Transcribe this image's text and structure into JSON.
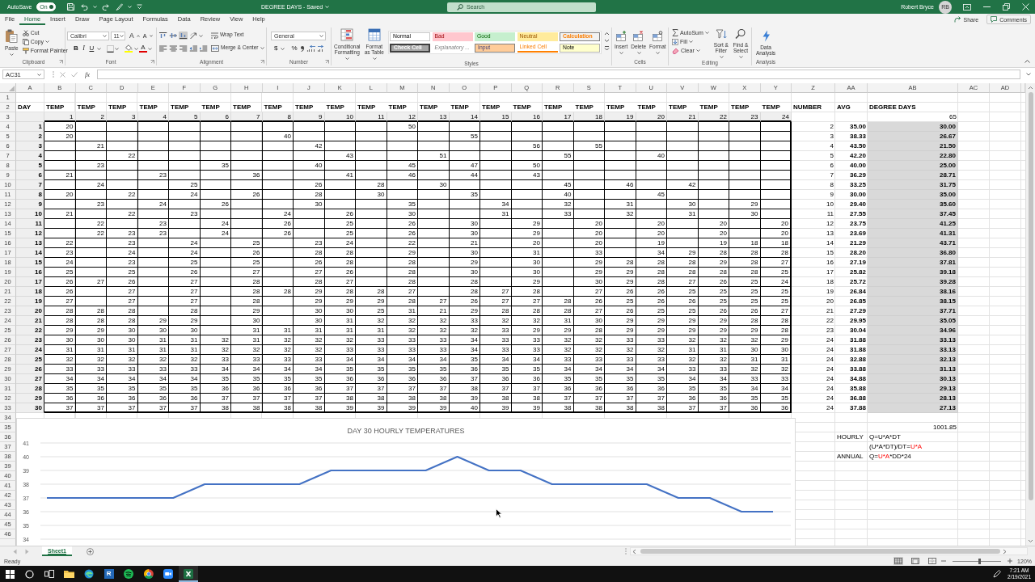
{
  "title_bar": {
    "autosave": {
      "label": "AutoSave",
      "on": true,
      "state_text": "On"
    },
    "document_title": "DEGREE DAYS - Saved",
    "search": {
      "placeholder": "Search"
    },
    "user": {
      "name": "Robert Bryce",
      "initials": "RB"
    }
  },
  "menu_tabs": [
    {
      "label": "File",
      "selected": false
    },
    {
      "label": "Home",
      "selected": true
    },
    {
      "label": "Insert",
      "selected": false
    },
    {
      "label": "Draw",
      "selected": false
    },
    {
      "label": "Page Layout",
      "selected": false
    },
    {
      "label": "Formulas",
      "selected": false
    },
    {
      "label": "Data",
      "selected": false
    },
    {
      "label": "Review",
      "selected": false
    },
    {
      "label": "View",
      "selected": false
    },
    {
      "label": "Help",
      "selected": false
    }
  ],
  "header_buttons": [
    {
      "label": "Share"
    },
    {
      "label": "Comments"
    }
  ],
  "ribbon": {
    "clipboard": {
      "label": "Clipboard",
      "paste": "Paste",
      "cut": "Cut",
      "copy": "Copy",
      "format_painter": "Format Painter"
    },
    "font": {
      "label": "Font",
      "font_name": "Calibri",
      "font_size": "11",
      "grow_font": "A",
      "shrink_font": "A",
      "bold": "B",
      "italic": "I",
      "underline": "U",
      "font_color": "A"
    },
    "alignment": {
      "label": "Alignment",
      "vertical_align": [
        {
          "selected": false
        },
        {
          "selected": false
        },
        {
          "selected": true
        }
      ],
      "wrap_text": "Wrap Text",
      "merge_center": "Merge & Center"
    },
    "number": {
      "label": "Number",
      "format": "General",
      "currency": "$",
      "percent": "%"
    },
    "styles": {
      "label": "Styles",
      "conditional_formatting": "Conditional Formatting",
      "format_as_table": "Format as Table",
      "cell_styles": [
        {
          "label": "Normal",
          "kind": "normal"
        },
        {
          "label": "Bad",
          "kind": "bad"
        },
        {
          "label": "Good",
          "kind": "good"
        },
        {
          "label": "Neutral",
          "kind": "neutral"
        },
        {
          "label": "Calculation",
          "kind": "calculation"
        },
        {
          "label": "Check Cell",
          "kind": "check"
        },
        {
          "label": "Explanatory ...",
          "kind": "explanatory"
        },
        {
          "label": "Input",
          "kind": "input"
        },
        {
          "label": "Linked Cell",
          "kind": "linked"
        },
        {
          "label": "Note",
          "kind": "note"
        }
      ]
    },
    "cells": {
      "label": "Cells",
      "buttons": [
        "Insert",
        "Delete",
        "Format"
      ]
    },
    "editing": {
      "label": "Editing",
      "autosum": "AutoSum",
      "fill": "Fill",
      "clear": "Clear",
      "sort_filter": "Sort & Filter",
      "find_select": "Find & Select"
    },
    "analysis": {
      "label": "Analysis",
      "data_analysis": "Data Analysis"
    }
  },
  "formula_bar": {
    "name_box": "AC31",
    "function_label": "fx"
  },
  "sheet": {
    "column_letters": [
      "A",
      "B",
      "C",
      "D",
      "E",
      "F",
      "G",
      "H",
      "I",
      "J",
      "K",
      "L",
      "M",
      "N",
      "O",
      "P",
      "Q",
      "R",
      "S",
      "T",
      "U",
      "V",
      "W",
      "X",
      "Y",
      "Z",
      "AA",
      "AB",
      "AC",
      "AD"
    ],
    "row_numbers": [
      "1",
      "2",
      "3",
      "4",
      "5",
      "6",
      "7",
      "8",
      "9",
      "10",
      "11",
      "12",
      "13",
      "14",
      "15",
      "16",
      "17",
      "18",
      "19",
      "20",
      "21",
      "22",
      "23",
      "24",
      "25",
      "26",
      "27",
      "28",
      "29",
      "30",
      "31",
      "32",
      "33",
      "34",
      "35",
      "36",
      "37",
      "38",
      "39",
      "40",
      "41",
      "42",
      "43",
      "44",
      "45",
      "46"
    ],
    "heading": {
      "day": "DAY",
      "temps": [
        "TEMP",
        "TEMP",
        "TEMP",
        "TEMP",
        "TEMP",
        "TEMP",
        "TEMP",
        "TEMP",
        "TEMP",
        "TEMP",
        "TEMP",
        "TEMP",
        "TEMP",
        "TEMP",
        "TEMP",
        "TEMP",
        "TEMP",
        "TEMP",
        "TEMP",
        "TEMP",
        "TEMP",
        "TEMP",
        "TEMP",
        "TEMP"
      ],
      "number": "NUMBER",
      "avg": "AVG",
      "degree_days": "DEGREE DAYS"
    },
    "hours": [
      "1",
      "2",
      "3",
      "4",
      "5",
      "6",
      "7",
      "8",
      "9",
      "10",
      "11",
      "12",
      "13",
      "14",
      "15",
      "16",
      "17",
      "18",
      "19",
      "20",
      "21",
      "22",
      "23",
      "24"
    ],
    "base_temperature": "65",
    "days": [
      {
        "day": "1",
        "temps": {
          "h1": "20",
          "h12": "50"
        },
        "count": "2",
        "avg": "35.00",
        "degree_days": "30.00"
      },
      {
        "day": "2",
        "temps": {
          "h1": "20",
          "h8": "40",
          "h14": "55"
        },
        "count": "3",
        "avg": "38.33",
        "degree_days": "26.67"
      },
      {
        "day": "3",
        "temps": {
          "h2": "21",
          "h9": "42",
          "h16": "56",
          "h18": "55"
        },
        "count": "4",
        "avg": "43.50",
        "degree_days": "21.50"
      },
      {
        "day": "4",
        "temps": {
          "h3": "22",
          "h10": "43",
          "h13": "51",
          "h17": "55",
          "h20": "40"
        },
        "count": "5",
        "avg": "42.20",
        "degree_days": "22.80"
      },
      {
        "day": "5",
        "temps": {
          "h2": "23",
          "h6": "35",
          "h9": "40",
          "h12": "45",
          "h14": "47",
          "h16": "50"
        },
        "count": "6",
        "avg": "40.00",
        "degree_days": "25.00"
      },
      {
        "day": "6",
        "temps": {
          "h1": "21",
          "h4": "23",
          "h7": "36",
          "h10": "41",
          "h12": "46",
          "h14": "44",
          "h16": "43"
        },
        "count": "7",
        "avg": "36.29",
        "degree_days": "28.71"
      },
      {
        "day": "7",
        "temps": {
          "h2": "24",
          "h5": "25",
          "h9": "26",
          "h11": "28",
          "h13": "30",
          "h17": "45",
          "h19": "46",
          "h21": "42"
        },
        "count": "8",
        "avg": "33.25",
        "degree_days": "31.75"
      },
      {
        "day": "8",
        "temps": {
          "h1": "20",
          "h3": "22",
          "h5": "24",
          "h7": "26",
          "h9": "28",
          "h11": "30",
          "h14": "35",
          "h17": "40",
          "h20": "45"
        },
        "count": "9",
        "avg": "30.00",
        "degree_days": "35.00"
      },
      {
        "day": "9",
        "temps": {
          "h2": "23",
          "h4": "24",
          "h6": "26",
          "h9": "30",
          "h12": "35",
          "h15": "34",
          "h17": "32",
          "h19": "31",
          "h21": "30",
          "h23": "29"
        },
        "count": "10",
        "avg": "29.40",
        "degree_days": "35.60"
      },
      {
        "day": "10",
        "temps": {
          "h1": "21",
          "h3": "22",
          "h5": "23",
          "h8": "24",
          "h10": "26",
          "h12": "30",
          "h15": "31",
          "h17": "33",
          "h19": "32",
          "h21": "31",
          "h23": "30"
        },
        "count": "11",
        "avg": "27.55",
        "degree_days": "37.45"
      },
      {
        "day": "11",
        "temps": {
          "h2": "22",
          "h4": "23",
          "h6": "24",
          "h8": "26",
          "h10": "25",
          "h12": "26",
          "h14": "30",
          "h16": "29",
          "h18": "20",
          "h20": "20",
          "h22": "20",
          "h24": "20"
        },
        "count": "12",
        "avg": "23.75",
        "degree_days": "41.25"
      },
      {
        "day": "12",
        "temps": {
          "h2": "22",
          "h3": "23",
          "h4": "23",
          "h6": "24",
          "h8": "26",
          "h10": "25",
          "h12": "26",
          "h14": "30",
          "h16": "29",
          "h18": "20",
          "h20": "20",
          "h22": "20",
          "h24": "20"
        },
        "count": "13",
        "avg": "23.69",
        "degree_days": "41.31"
      },
      {
        "day": "13",
        "temps": {
          "h1": "22",
          "h3": "23",
          "h5": "24",
          "h7": "25",
          "h9": "23",
          "h10": "24",
          "h12": "22",
          "h14": "21",
          "h16": "20",
          "h18": "20",
          "h20": "19",
          "h22": "19",
          "h23": "18",
          "h24": "18"
        },
        "count": "14",
        "avg": "21.29",
        "degree_days": "43.71"
      },
      {
        "day": "14",
        "temps": {
          "h1": "23",
          "h3": "24",
          "h5": "24",
          "h7": "26",
          "h9": "28",
          "h10": "28",
          "h12": "29",
          "h14": "30",
          "h16": "31",
          "h18": "33",
          "h20": "34",
          "h21": "29",
          "h22": "28",
          "h23": "28",
          "h24": "28"
        },
        "count": "15",
        "avg": "28.20",
        "degree_days": "36.80"
      },
      {
        "day": "15",
        "temps": {
          "h1": "24",
          "h3": "23",
          "h5": "25",
          "h7": "25",
          "h9": "26",
          "h10": "28",
          "h12": "28",
          "h14": "29",
          "h16": "30",
          "h18": "29",
          "h19": "28",
          "h20": "28",
          "h21": "28",
          "h22": "29",
          "h23": "28",
          "h24": "27"
        },
        "count": "16",
        "avg": "27.19",
        "degree_days": "37.81"
      },
      {
        "day": "16",
        "temps": {
          "h1": "25",
          "h3": "25",
          "h5": "26",
          "h7": "27",
          "h9": "27",
          "h10": "26",
          "h12": "28",
          "h14": "30",
          "h16": "30",
          "h18": "29",
          "h19": "29",
          "h20": "28",
          "h21": "28",
          "h22": "28",
          "h23": "28",
          "h24": "25"
        },
        "count": "17",
        "avg": "25.82",
        "degree_days": "39.18"
      },
      {
        "day": "17",
        "temps": {
          "h1": "26",
          "h2": "27",
          "h3": "26",
          "h5": "27",
          "h7": "28",
          "h9": "28",
          "h10": "27",
          "h12": "28",
          "h14": "28",
          "h16": "29",
          "h18": "30",
          "h19": "29",
          "h20": "28",
          "h21": "27",
          "h22": "26",
          "h23": "25",
          "h24": "24"
        },
        "count": "18",
        "avg": "25.72",
        "degree_days": "39.28"
      },
      {
        "day": "18",
        "temps": {
          "h1": "26",
          "h3": "27",
          "h5": "27",
          "h7": "28",
          "h8": "28",
          "h9": "29",
          "h10": "28",
          "h11": "28",
          "h12": "27",
          "h14": "28",
          "h15": "27",
          "h16": "28",
          "h18": "27",
          "h19": "26",
          "h20": "26",
          "h21": "25",
          "h22": "25",
          "h23": "25",
          "h24": "25"
        },
        "count": "19",
        "avg": "26.84",
        "degree_days": "38.16"
      },
      {
        "day": "19",
        "temps": {
          "h1": "27",
          "h3": "27",
          "h5": "27",
          "h7": "28",
          "h9": "29",
          "h10": "29",
          "h11": "29",
          "h12": "28",
          "h13": "27",
          "h14": "26",
          "h15": "27",
          "h16": "27",
          "h17": "28",
          "h18": "26",
          "h19": "25",
          "h20": "26",
          "h21": "26",
          "h22": "25",
          "h23": "25",
          "h24": "25"
        },
        "count": "20",
        "avg": "26.85",
        "degree_days": "38.15"
      },
      {
        "day": "20",
        "temps": {
          "h1": "28",
          "h2": "28",
          "h3": "28",
          "h5": "28",
          "h7": "29",
          "h9": "30",
          "h10": "30",
          "h11": "25",
          "h12": "31",
          "h13": "21",
          "h14": "29",
          "h15": "28",
          "h16": "28",
          "h17": "28",
          "h18": "27",
          "h19": "26",
          "h20": "25",
          "h21": "25",
          "h22": "26",
          "h23": "26",
          "h24": "27"
        },
        "count": "21",
        "avg": "27.29",
        "degree_days": "37.71"
      },
      {
        "day": "21",
        "temps": {
          "h1": "28",
          "h2": "28",
          "h3": "28",
          "h4": "29",
          "h5": "29",
          "h7": "30",
          "h9": "30",
          "h10": "31",
          "h11": "32",
          "h12": "32",
          "h13": "32",
          "h14": "33",
          "h15": "32",
          "h16": "32",
          "h17": "31",
          "h18": "30",
          "h19": "29",
          "h20": "29",
          "h21": "29",
          "h22": "29",
          "h23": "28",
          "h24": "28"
        },
        "count": "22",
        "avg": "29.95",
        "degree_days": "35.05"
      },
      {
        "day": "22",
        "temps": {
          "h1": "29",
          "h2": "29",
          "h3": "30",
          "h4": "30",
          "h5": "30",
          "h7": "31",
          "h8": "31",
          "h9": "31",
          "h10": "31",
          "h11": "31",
          "h12": "32",
          "h13": "32",
          "h14": "32",
          "h15": "33",
          "h16": "29",
          "h17": "29",
          "h18": "28",
          "h19": "29",
          "h20": "29",
          "h21": "29",
          "h22": "29",
          "h23": "29",
          "h24": "28"
        },
        "count": "23",
        "avg": "30.04",
        "degree_days": "34.96"
      },
      {
        "day": "23",
        "temps": {
          "h1": "30",
          "h2": "30",
          "h3": "30",
          "h4": "31",
          "h5": "31",
          "h6": "32",
          "h7": "31",
          "h8": "32",
          "h9": "32",
          "h10": "32",
          "h11": "33",
          "h12": "33",
          "h13": "33",
          "h14": "34",
          "h15": "33",
          "h16": "33",
          "h17": "32",
          "h18": "32",
          "h19": "33",
          "h20": "33",
          "h21": "32",
          "h22": "32",
          "h23": "32",
          "h24": "29"
        },
        "count": "24",
        "avg": "31.88",
        "degree_days": "33.13"
      },
      {
        "day": "24",
        "temps": {
          "h1": "31",
          "h2": "31",
          "h3": "31",
          "h4": "31",
          "h5": "31",
          "h6": "32",
          "h7": "32",
          "h8": "32",
          "h9": "32",
          "h10": "33",
          "h11": "33",
          "h12": "33",
          "h13": "33",
          "h14": "34",
          "h15": "33",
          "h16": "33",
          "h17": "32",
          "h18": "32",
          "h19": "32",
          "h20": "32",
          "h21": "31",
          "h22": "31",
          "h23": "30",
          "h24": "30"
        },
        "count": "24",
        "avg": "31.88",
        "degree_days": "33.13"
      },
      {
        "day": "25",
        "temps": {
          "h1": "32",
          "h2": "32",
          "h3": "32",
          "h4": "32",
          "h5": "32",
          "h6": "33",
          "h7": "33",
          "h8": "33",
          "h9": "33",
          "h10": "34",
          "h11": "34",
          "h12": "34",
          "h13": "34",
          "h14": "35",
          "h15": "34",
          "h16": "34",
          "h17": "33",
          "h18": "33",
          "h19": "33",
          "h20": "33",
          "h21": "32",
          "h22": "32",
          "h23": "31",
          "h24": "31"
        },
        "count": "24",
        "avg": "32.88",
        "degree_days": "32.13"
      },
      {
        "day": "26",
        "temps": {
          "h1": "33",
          "h2": "33",
          "h3": "33",
          "h4": "33",
          "h5": "33",
          "h6": "34",
          "h7": "34",
          "h8": "34",
          "h9": "34",
          "h10": "35",
          "h11": "35",
          "h12": "35",
          "h13": "35",
          "h14": "36",
          "h15": "35",
          "h16": "35",
          "h17": "34",
          "h18": "34",
          "h19": "34",
          "h20": "34",
          "h21": "33",
          "h22": "33",
          "h23": "32",
          "h24": "32"
        },
        "count": "24",
        "avg": "33.88",
        "degree_days": "31.13"
      },
      {
        "day": "27",
        "temps": {
          "h1": "34",
          "h2": "34",
          "h3": "34",
          "h4": "34",
          "h5": "34",
          "h6": "35",
          "h7": "35",
          "h8": "35",
          "h9": "35",
          "h10": "36",
          "h11": "36",
          "h12": "36",
          "h13": "36",
          "h14": "37",
          "h15": "36",
          "h16": "36",
          "h17": "35",
          "h18": "35",
          "h19": "35",
          "h20": "35",
          "h21": "34",
          "h22": "34",
          "h23": "33",
          "h24": "33"
        },
        "count": "24",
        "avg": "34.88",
        "degree_days": "30.13"
      },
      {
        "day": "28",
        "temps": {
          "h1": "35",
          "h2": "35",
          "h3": "35",
          "h4": "35",
          "h5": "35",
          "h6": "36",
          "h7": "36",
          "h8": "36",
          "h9": "36",
          "h10": "37",
          "h11": "37",
          "h12": "37",
          "h13": "37",
          "h14": "38",
          "h15": "37",
          "h16": "37",
          "h17": "36",
          "h18": "36",
          "h19": "36",
          "h20": "36",
          "h21": "35",
          "h22": "35",
          "h23": "34",
          "h24": "34"
        },
        "count": "24",
        "avg": "35.88",
        "degree_days": "29.13"
      },
      {
        "day": "29",
        "temps": {
          "h1": "36",
          "h2": "36",
          "h3": "36",
          "h4": "36",
          "h5": "36",
          "h6": "37",
          "h7": "37",
          "h8": "37",
          "h9": "37",
          "h10": "38",
          "h11": "38",
          "h12": "38",
          "h13": "38",
          "h14": "39",
          "h15": "38",
          "h16": "38",
          "h17": "37",
          "h18": "37",
          "h19": "37",
          "h20": "37",
          "h21": "36",
          "h22": "36",
          "h23": "35",
          "h24": "35"
        },
        "count": "24",
        "avg": "36.88",
        "degree_days": "28.13"
      },
      {
        "day": "30",
        "temps": {
          "h1": "37",
          "h2": "37",
          "h3": "37",
          "h4": "37",
          "h5": "37",
          "h6": "38",
          "h7": "38",
          "h8": "38",
          "h9": "38",
          "h10": "39",
          "h11": "39",
          "h12": "39",
          "h13": "39",
          "h14": "40",
          "h15": "39",
          "h16": "39",
          "h17": "38",
          "h18": "38",
          "h19": "38",
          "h20": "38",
          "h21": "37",
          "h22": "37",
          "h23": "36",
          "h24": "36"
        },
        "count": "24",
        "avg": "37.88",
        "degree_days": "27.13"
      }
    ],
    "total_degree_days": "1001.85",
    "formulas": [
      {
        "label": "HOURLY",
        "segments": [
          {
            "text": "Q=U*A*DT",
            "highlighted": false
          }
        ]
      },
      {
        "segments": [
          {
            "text": "(U*A*DT)/DT=",
            "highlighted": false
          },
          {
            "text": "U*A",
            "highlighted": true
          }
        ]
      },
      {
        "label": "ANNUAL",
        "segments": [
          {
            "text": "Q=",
            "highlighted": false
          },
          {
            "text": "U*A",
            "highlighted": true
          },
          {
            "text": "*DD*24",
            "highlighted": false
          }
        ]
      }
    ],
    "chart": {
      "chart_data": {
        "type": "line",
        "title": "DAY 30 HOURLY TEMPERATURES",
        "grid": true,
        "ylim": [
          34,
          41
        ],
        "yticks": [
          34,
          35,
          36,
          37,
          38,
          39,
          40,
          41
        ],
        "values": [
          37,
          37,
          37,
          37,
          37,
          38,
          38,
          38,
          38,
          39,
          39,
          39,
          39,
          40,
          39,
          39,
          38,
          38,
          38,
          38,
          37,
          37,
          36,
          36
        ]
      }
    }
  },
  "sheet_tabs": [
    {
      "label": "Sheet1",
      "selected": true
    }
  ],
  "status_bar": {
    "status": "Ready",
    "views": [
      {
        "selected": true
      },
      {
        "selected": false
      },
      {
        "selected": false
      }
    ],
    "zoom": {
      "level": 0.55,
      "reading": "120%"
    }
  },
  "taskbar": {
    "apps": [
      {
        "kind": "start",
        "active": false
      },
      {
        "kind": "search",
        "active": false
      },
      {
        "kind": "task_view",
        "active": false
      },
      {
        "kind": "folder",
        "active": false
      },
      {
        "kind": "swirl",
        "active": false
      },
      {
        "kind": "letter",
        "text": "R",
        "active": false
      },
      {
        "kind": "waves",
        "active": false
      },
      {
        "kind": "segmented",
        "active": false
      },
      {
        "kind": "camera",
        "active": false
      },
      {
        "kind": "cross_tile",
        "active": true
      }
    ],
    "time": "7:21 AM",
    "date": "2/19/2021"
  }
}
